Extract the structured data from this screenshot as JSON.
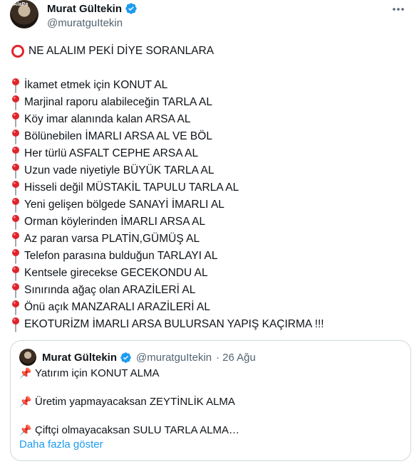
{
  "tweet": {
    "author_name": "Murat Gültekin",
    "author_handle": "@muratguItekin",
    "avatar_label": "AlaPa",
    "headline": "NE ALALIM PEKİ DİYE SORANLARA",
    "items": [
      "İkamet etmek için KONUT AL",
      "Marjinal raporu alabileceğin TARLA AL",
      "Köy imar  alanında kalan ARSA AL",
      "Bölünebilen İMARLI ARSA AL VE BÖL",
      "Her türlü ASFALT CEPHE ARSA AL",
      "Uzun vade niyetiyle BÜYÜK TARLA AL",
      "Hisseli değil MÜSTAKİL TAPULU TARLA AL",
      "Yeni gelişen bölgede SANAYİ İMARLI AL",
      "Orman köylerinden İMARLI ARSA AL",
      "Az paran varsa PLATİN,GÜMÜŞ AL",
      "Telefon parasına bulduğun TARLAYI AL",
      "Kentsele girecekse GECEKONDU AL",
      "Sınırında ağaç olan ARAZİLERİ AL",
      "Önü açık MANZARALI ARAZİLERİ AL",
      "EKOTURİZM İMARLI ARSA BULURSAN YAPIŞ KAÇIRMA !!!"
    ]
  },
  "quoted": {
    "author_name": "Murat Gültekin",
    "author_handle": "@muratguItekin",
    "separator": "·",
    "date": "26 Ağu",
    "lines": [
      "Yatırım için KONUT ALMA",
      "Üretim yapmayacaksan ZEYTİNLİK ALMA",
      "Çiftçi olmayacaksan SULU TARLA ALMA…"
    ],
    "show_more": "Daha fazla göster"
  },
  "icons": {
    "verified": "verified-badge-icon",
    "more": "more-options-icon",
    "ring": "heavy-circle-icon",
    "pin": "round-pushpin-icon",
    "quote_pin": "pushpin-icon"
  },
  "colors": {
    "accent": "#1d9bf0",
    "text": "#0f1419",
    "muted": "#536471",
    "red": "#e0242b"
  }
}
